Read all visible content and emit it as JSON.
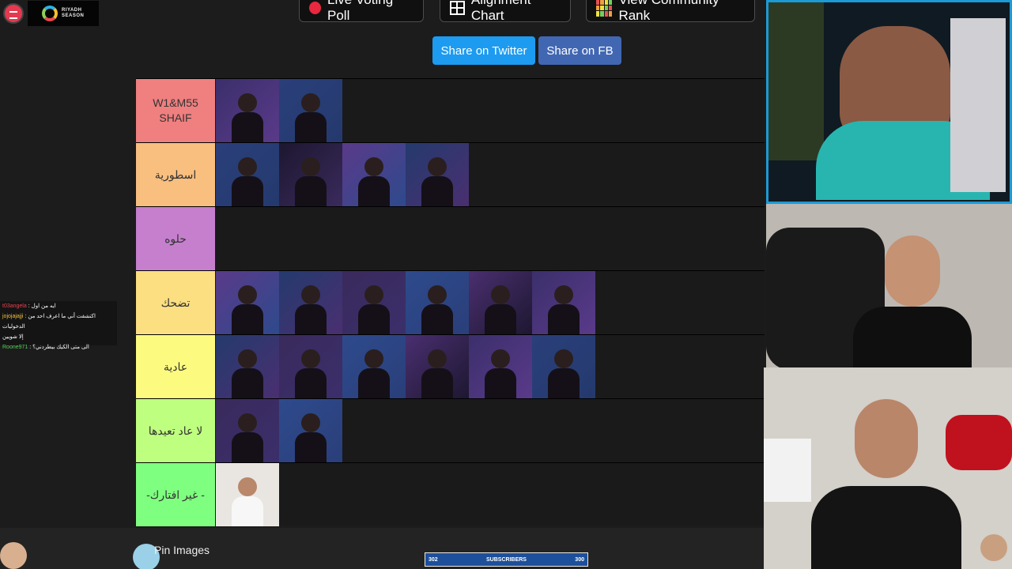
{
  "brand": {
    "riyadh_line1": "RIYADH",
    "riyadh_line2": "SEASON"
  },
  "toolbar": {
    "live_voting": "Live Voting Poll",
    "alignment_chart": "Alignment Chart",
    "community_rank": "View Community Rank"
  },
  "share": {
    "twitter": "Share on Twitter",
    "facebook": "Share on FB"
  },
  "tiers": [
    {
      "label": "W1&M55 SHAIF",
      "color": "#f07f7f",
      "count": 2
    },
    {
      "label": "اسطورية",
      "color": "#f8bf7f",
      "count": 4
    },
    {
      "label": "حلوه",
      "color": "#c57fcd",
      "count": 0
    },
    {
      "label": "تضحك",
      "color": "#fcdf80",
      "count": 6
    },
    {
      "label": "عادية",
      "color": "#fcfb7f",
      "count": 6
    },
    {
      "label": "لا عاد تعيدها",
      "color": "#bfff7f",
      "count": 2
    },
    {
      "label": "-غير افتارك -",
      "color": "#7fff7f",
      "count": 1
    }
  ],
  "chat": [
    {
      "user": "t03angela",
      "text": "ايه من اول"
    },
    {
      "user": "jojojajajji",
      "text": "اكتشفت أني ما اعرف احد من الدخوليات"
    },
    {
      "user": "",
      "text": "إلا شويين"
    },
    {
      "user": "Roone971",
      "text": "الى متى الكيك بيطردني؟"
    }
  ],
  "footer": {
    "pin_images": "Pin Images",
    "subs_left": "302",
    "subs_label": "SUBSCRIBERS",
    "subs_right": "300"
  },
  "colors": {
    "twitter": "#1d9bf0",
    "facebook": "#4267b2",
    "cam_border": "#1c9ad6"
  }
}
